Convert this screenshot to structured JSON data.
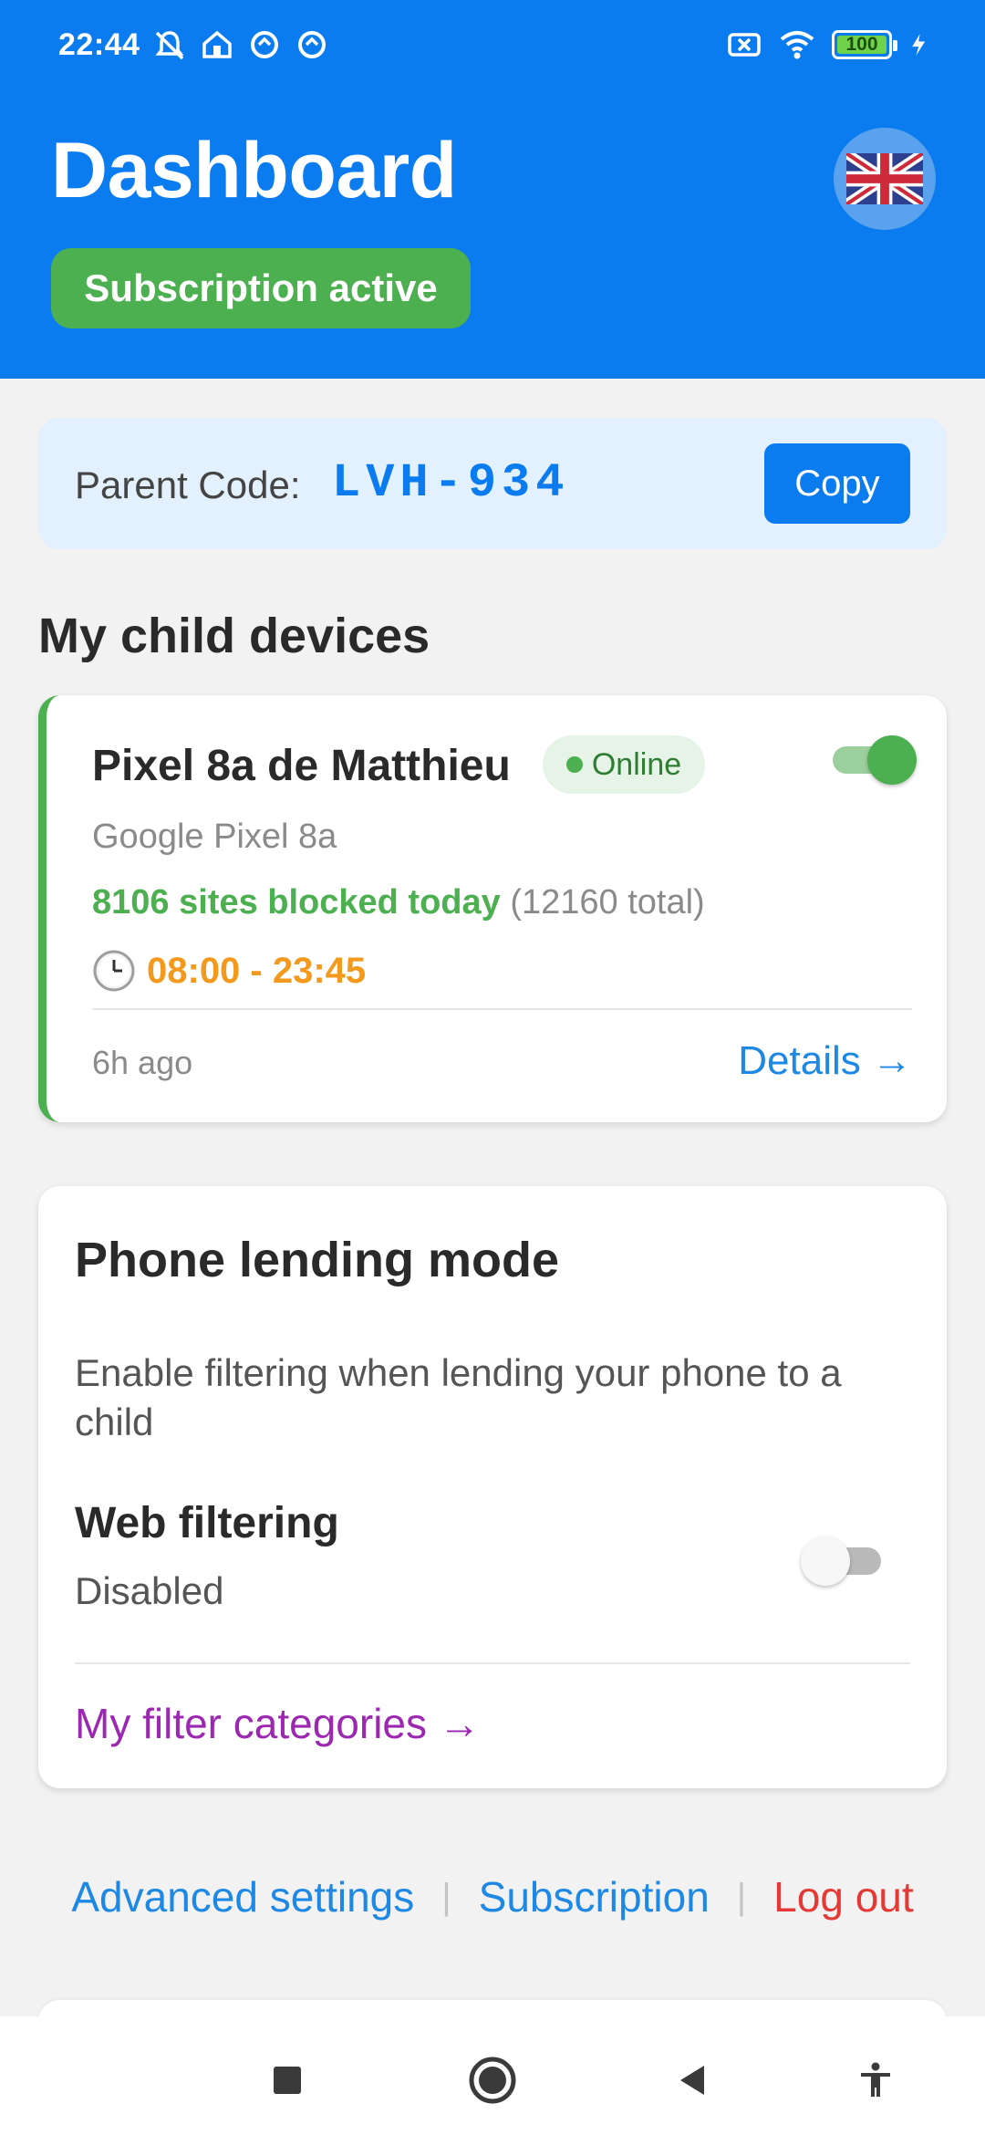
{
  "status_bar": {
    "time": "22:44",
    "battery": "100",
    "icons_left": [
      "mute-icon",
      "home-icon",
      "data-saver-icon",
      "data-saver-icon"
    ],
    "icons_right": [
      "sim-error-icon",
      "wifi-icon",
      "battery-icon",
      "charging-icon"
    ]
  },
  "header": {
    "title": "Dashboard",
    "subscription_badge": "Subscription active",
    "language_icon": "uk-flag-icon"
  },
  "parent_code": {
    "label": "Parent Code:",
    "value": "LVH-934",
    "copy_label": "Copy"
  },
  "devices_section": {
    "title": "My child devices",
    "devices": [
      {
        "name": "Pixel 8a de Matthieu",
        "status": "Online",
        "enabled": true,
        "model": "Google Pixel 8a",
        "blocked_today": "8106 sites blocked today",
        "blocked_total": "(12160 total)",
        "schedule": "08:00 - 23:45",
        "schedule_icon": "clock-icon",
        "last_seen": "6h ago",
        "details_label": "Details →"
      }
    ]
  },
  "lending": {
    "title": "Phone lending mode",
    "description": "Enable filtering when lending your phone to a child",
    "web_filtering_label": "Web filtering",
    "web_filtering_status": "Disabled",
    "web_filtering_enabled": false,
    "filter_categories_label": "My filter categories →"
  },
  "footer_links": {
    "advanced": "Advanced settings",
    "subscription": "Subscription",
    "logout": "Log out",
    "separator": "|"
  },
  "navigation_bar": {
    "buttons": [
      "recents-icon",
      "home-icon",
      "back-icon",
      "accessibility-icon"
    ]
  },
  "colors": {
    "primary": "#0a7cf0",
    "success": "#4caf50",
    "warning": "#f39a1e",
    "purple": "#9c27b0",
    "danger": "#e53935"
  }
}
